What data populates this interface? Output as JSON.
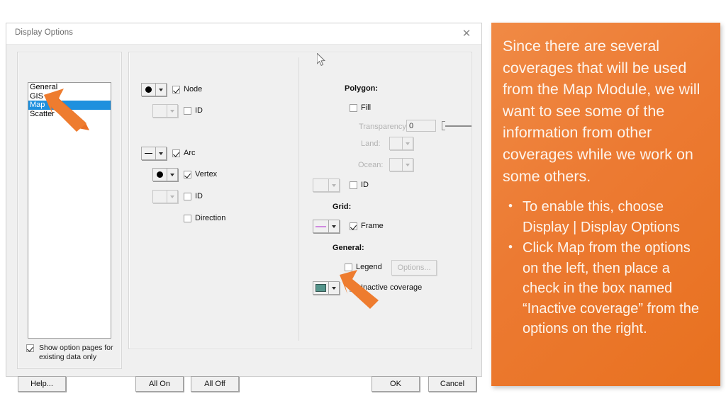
{
  "dialog": {
    "title": "Display Options",
    "close_icon": "close-icon",
    "list": {
      "items": [
        "General",
        "GIS",
        "Map",
        "Scatter"
      ],
      "selected": "Map"
    },
    "show_option_pages": {
      "label_line1": "Show option pages for",
      "label_line2": "existing data only",
      "checked": true
    },
    "middle_column": {
      "node": {
        "label": "Node",
        "checked": true,
        "symbol": "dot"
      },
      "node_id": {
        "label": "ID",
        "checked": false,
        "symbol": "none"
      },
      "arc": {
        "label": "Arc",
        "checked": true,
        "symbol": "line"
      },
      "vertex": {
        "label": "Vertex",
        "checked": true,
        "symbol": "dot"
      },
      "arc_id": {
        "label": "ID",
        "checked": false,
        "symbol": "none"
      },
      "direction": {
        "label": "Direction",
        "checked": false
      }
    },
    "right_column": {
      "polygon_heading": "Polygon:",
      "fill": {
        "label": "Fill",
        "checked": false
      },
      "transparency": {
        "label": "Transparency:",
        "value": "0"
      },
      "land": {
        "label": "Land:"
      },
      "ocean": {
        "label": "Ocean:"
      },
      "polygon_id": {
        "label": "ID",
        "checked": false
      },
      "grid_heading": "Grid:",
      "frame": {
        "label": "Frame",
        "checked": true,
        "swatch": "#cf8ae0"
      },
      "general_heading": "General:",
      "legend": {
        "label": "Legend",
        "checked": false
      },
      "legend_options_button": "Options...",
      "inactive_coverage": {
        "label": "Inactive coverage",
        "checked": true,
        "swatch": "#55958c"
      }
    },
    "buttons": {
      "help": "Help...",
      "all_on": "All On",
      "all_off": "All Off",
      "ok": "OK",
      "cancel": "Cancel"
    }
  },
  "slide": {
    "accent_color": "#ec7a32",
    "paragraph": "Since there are several coverages that will be used from the Map Module, we will want to see some of the information from other coverages while we work on some others.",
    "bullets": [
      "To enable this, choose Display | Display Options",
      "Click Map from the options on the left, then place a check in the box named “Inactive coverage” from the options on the right."
    ]
  }
}
